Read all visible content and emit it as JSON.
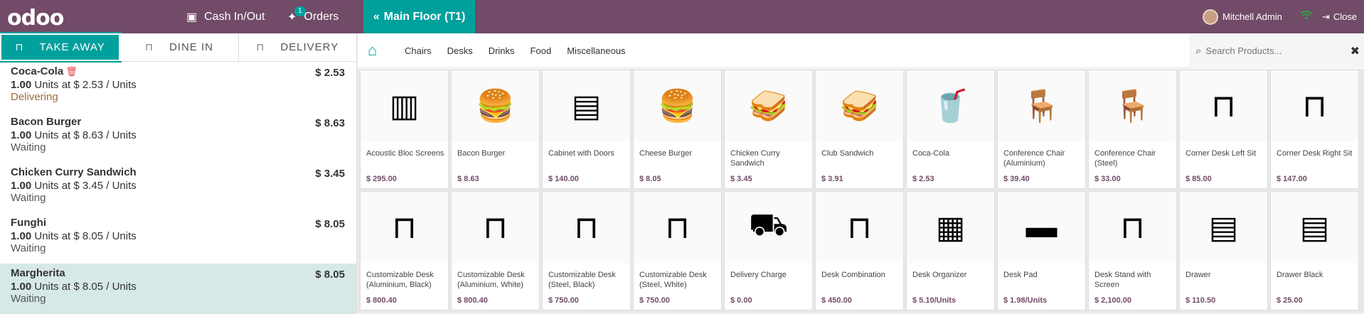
{
  "header": {
    "logo": "odoo",
    "cash_label": "Cash In/Out",
    "orders_label": "Orders",
    "orders_badge": "1",
    "floor_label": "Main Floor (T1)",
    "user_name": "Mitchell Admin",
    "close_label": "Close"
  },
  "modes": [
    {
      "label": "TAKE AWAY",
      "icon": "table-icon",
      "active": true
    },
    {
      "label": "DINE IN",
      "icon": "table-icon",
      "active": false
    },
    {
      "label": "DELIVERY",
      "icon": "table-icon",
      "active": false
    }
  ],
  "order_lines": [
    {
      "name": "Coca-Cola",
      "price": "$ 2.53",
      "qty": "1.00",
      "unit_text": "Units at $ 2.53 / Units",
      "status": "Delivering"
    },
    {
      "name": "Bacon Burger",
      "price": "$ 8.63",
      "qty": "1.00",
      "unit_text": "Units at $ 8.63 / Units",
      "status": "Waiting"
    },
    {
      "name": "Chicken Curry Sandwich",
      "price": "$ 3.45",
      "qty": "1.00",
      "unit_text": "Units at $ 3.45 / Units",
      "status": "Waiting"
    },
    {
      "name": "Funghi",
      "price": "$ 8.05",
      "qty": "1.00",
      "unit_text": "Units at $ 8.05 / Units",
      "status": "Waiting"
    },
    {
      "name": "Margherita",
      "price": "$ 8.05",
      "qty": "1.00",
      "unit_text": "Units at $ 8.05 / Units",
      "status": "Waiting"
    }
  ],
  "categories": [
    "Chairs",
    "Desks",
    "Drinks",
    "Food",
    "Miscellaneous"
  ],
  "search": {
    "placeholder": "Search Products..."
  },
  "products_row1": [
    {
      "name": "Acoustic Bloc Screens",
      "price": "$ 295.00",
      "icon": "screen-icon"
    },
    {
      "name": "Bacon Burger",
      "price": "$ 8.63",
      "icon": "burger-icon"
    },
    {
      "name": "Cabinet with Doors",
      "price": "$ 140.00",
      "icon": "cabinet-icon"
    },
    {
      "name": "Cheese Burger",
      "price": "$ 8.05",
      "icon": "burger-icon"
    },
    {
      "name": "Chicken Curry Sandwich",
      "price": "$ 3.45",
      "icon": "sandwich-icon"
    },
    {
      "name": "Club Sandwich",
      "price": "$ 3.91",
      "icon": "sandwich-icon"
    },
    {
      "name": "Coca-Cola",
      "price": "$ 2.53",
      "icon": "cola-icon"
    },
    {
      "name": "Conference Chair (Aluminium)",
      "price": "$ 39.40",
      "icon": "chair-icon"
    },
    {
      "name": "Conference Chair (Steel)",
      "price": "$ 33.00",
      "icon": "chair-icon"
    },
    {
      "name": "Corner Desk Left Sit",
      "price": "$ 85.00",
      "icon": "desk-icon"
    },
    {
      "name": "Corner Desk Right Sit",
      "price": "$ 147.00",
      "icon": "desk-icon"
    }
  ],
  "products_row2": [
    {
      "name": "Customizable Desk (Aluminium, Black)",
      "price": "$ 800.40",
      "icon": "desk-icon"
    },
    {
      "name": "Customizable Desk (Aluminium, White)",
      "price": "$ 800.40",
      "icon": "desk-icon"
    },
    {
      "name": "Customizable Desk (Steel, Black)",
      "price": "$ 750.00",
      "icon": "desk-icon"
    },
    {
      "name": "Customizable Desk (Steel, White)",
      "price": "$ 750.00",
      "icon": "desk-icon"
    },
    {
      "name": "Delivery Charge",
      "price": "$ 0.00",
      "icon": "delivery-icon"
    },
    {
      "name": "Desk Combination",
      "price": "$ 450.00",
      "icon": "desk-icon"
    },
    {
      "name": "Desk Organizer",
      "price": "$ 5.10/Units",
      "icon": "organizer-icon"
    },
    {
      "name": "Desk Pad",
      "price": "$ 1.98/Units",
      "icon": "pad-icon"
    },
    {
      "name": "Desk Stand with Screen",
      "price": "$ 2,100.00",
      "icon": "desk-icon"
    },
    {
      "name": "Drawer",
      "price": "$ 110.50",
      "icon": "drawer-icon"
    },
    {
      "name": "Drawer Black",
      "price": "$ 25.00",
      "icon": "drawer-icon"
    }
  ],
  "colors": {
    "brand": "#714b67",
    "accent": "#00a09d",
    "selected_line": "#d7e9e6"
  }
}
